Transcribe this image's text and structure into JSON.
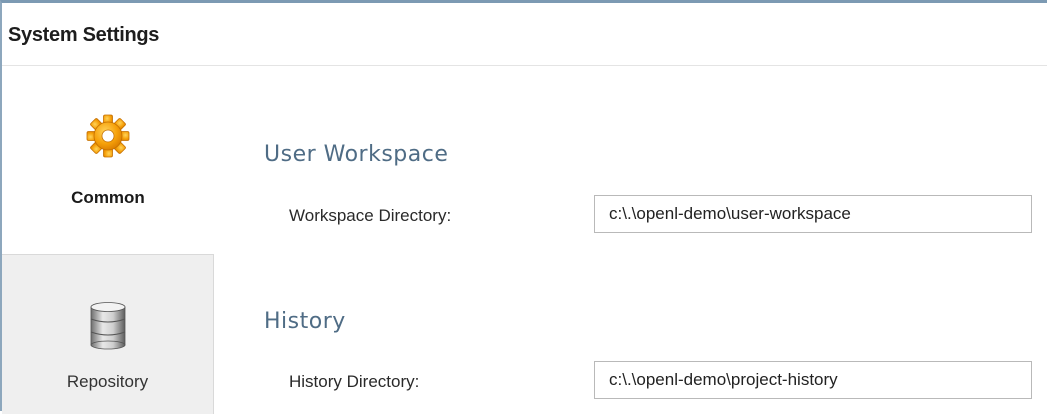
{
  "window": {
    "title": "System Settings"
  },
  "sidebar": {
    "items": [
      {
        "label": "Common",
        "icon": "gear-icon",
        "active": true
      },
      {
        "label": "Repository",
        "icon": "database-icon",
        "active": false
      }
    ]
  },
  "sections": [
    {
      "title": "User Workspace",
      "field": {
        "label": "Workspace Directory:",
        "value": "c:\\.\\openl-demo\\user-workspace"
      }
    },
    {
      "title": "History",
      "field": {
        "label": "History Directory:",
        "value": "c:\\.\\openl-demo\\project-history"
      }
    }
  ],
  "colors": {
    "accent_text": "#4f6c85",
    "gear": "#f6a10a",
    "sidebar_inactive_bg": "#efefef",
    "window_border": "#7c9ab3"
  }
}
